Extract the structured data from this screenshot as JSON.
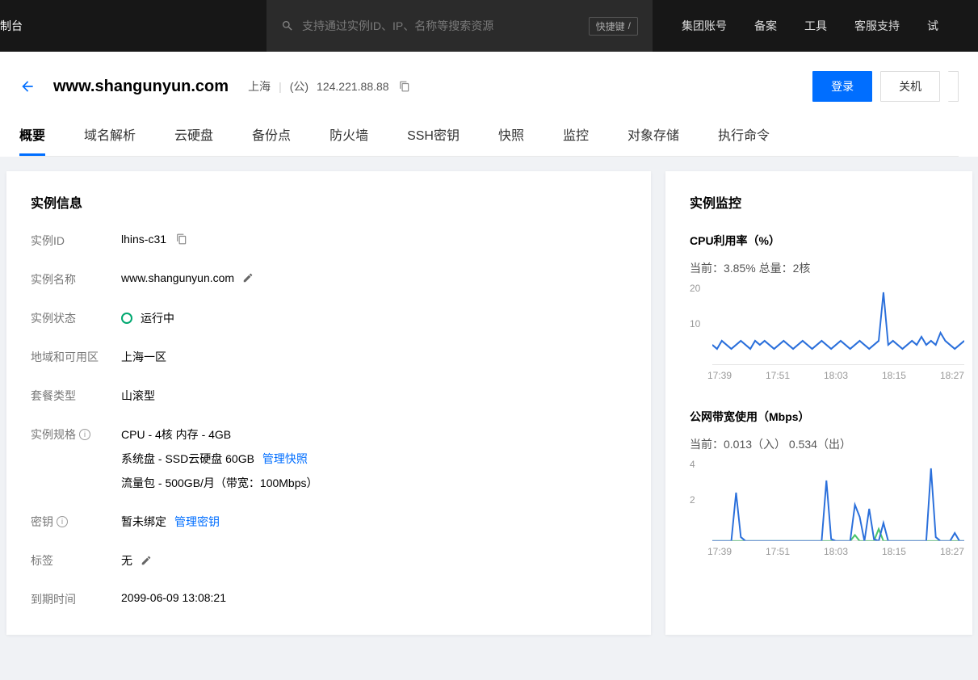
{
  "topbar": {
    "console": "制台",
    "search_placeholder": "支持通过实例ID、IP、名称等搜索资源",
    "hotkey_label": "快捷键",
    "links": [
      "集团账号",
      "备案",
      "工具",
      "客服支持",
      "试"
    ]
  },
  "header": {
    "title": "www.shangunyun.com",
    "region": "上海",
    "ip_prefix": "(公)",
    "ip": "124.221.88.88",
    "btn_login": "登录",
    "btn_shutdown": "关机"
  },
  "tabs": [
    "概要",
    "域名解析",
    "云硬盘",
    "备份点",
    "防火墙",
    "SSH密钥",
    "快照",
    "监控",
    "对象存储",
    "执行命令"
  ],
  "active_tab": 0,
  "info": {
    "panel_title": "实例信息",
    "labels": {
      "id": "实例ID",
      "name": "实例名称",
      "status": "实例状态",
      "zone": "地域和可用区",
      "plan": "套餐类型",
      "spec": "实例规格",
      "key": "密钥",
      "tag": "标签",
      "expire": "到期时间"
    },
    "id": "lhins-c31",
    "name": "www.shangunyun.com",
    "status": "运行中",
    "zone": "上海一区",
    "plan": "山滚型",
    "spec_cpu": "CPU - 4核 内存 - 4GB",
    "spec_disk": "系统盘 - SSD云硬盘 60GB",
    "spec_disk_link": "管理快照",
    "spec_bw": "流量包 - 500GB/月（带宽：100Mbps）",
    "key_value": "暂未绑定",
    "key_link": "管理密钥",
    "tag_value": "无",
    "expire": "2099-06-09 13:08:21"
  },
  "monitor": {
    "panel_title": "实例监控",
    "cpu": {
      "title": "CPU利用率（%）",
      "sub": "当前：3.85% 总量：2核"
    },
    "bw": {
      "title": "公网带宽使用（Mbps）",
      "sub": "当前：0.013（入） 0.534（出）"
    },
    "xlabels": [
      "17:39",
      "17:51",
      "18:03",
      "18:15",
      "18:27"
    ]
  },
  "chart_data": [
    {
      "type": "line",
      "title": "CPU利用率（%）",
      "xlabel": "",
      "ylabel": "%",
      "ylim": [
        0,
        20
      ],
      "yticks": [
        10,
        20
      ],
      "x_ticks": [
        "17:39",
        "17:51",
        "18:03",
        "18:15",
        "18:27"
      ],
      "series": [
        {
          "name": "CPU",
          "color": "#2a6fdb",
          "values": [
            5,
            4,
            6,
            5,
            4,
            5,
            6,
            5,
            4,
            6,
            5,
            6,
            5,
            4,
            5,
            6,
            5,
            4,
            5,
            6,
            5,
            4,
            5,
            6,
            5,
            4,
            5,
            6,
            5,
            4,
            5,
            6,
            5,
            4,
            5,
            6,
            18,
            5,
            6,
            5,
            4,
            5,
            6,
            5,
            7,
            5,
            6,
            5,
            8,
            6,
            5,
            4,
            5,
            6
          ]
        }
      ]
    },
    {
      "type": "line",
      "title": "公网带宽使用（Mbps）",
      "xlabel": "",
      "ylabel": "Mbps",
      "ylim": [
        0,
        4
      ],
      "yticks": [
        2,
        4
      ],
      "x_ticks": [
        "17:39",
        "17:51",
        "18:03",
        "18:15",
        "18:27"
      ],
      "series": [
        {
          "name": "入",
          "color": "#49c46c",
          "values": [
            0,
            0,
            0,
            0,
            0,
            0,
            0,
            0,
            0,
            0,
            0,
            0,
            0,
            0,
            0,
            0,
            0,
            0,
            0,
            0,
            0,
            0,
            0,
            0,
            0,
            0,
            0,
            0,
            0,
            0,
            0.3,
            0,
            0,
            0,
            0,
            0.6,
            0,
            0,
            0,
            0,
            0,
            0,
            0,
            0,
            0,
            0,
            0,
            0,
            0,
            0,
            0,
            0,
            0,
            0
          ]
        },
        {
          "name": "出",
          "color": "#2a6fdb",
          "values": [
            0,
            0,
            0,
            0,
            0,
            2.4,
            0.2,
            0,
            0,
            0,
            0,
            0,
            0,
            0,
            0,
            0,
            0,
            0,
            0,
            0,
            0,
            0,
            0,
            0,
            3.0,
            0.1,
            0,
            0,
            0,
            0,
            1.8,
            1.2,
            0,
            1.6,
            0.1,
            0,
            0.9,
            0,
            0,
            0,
            0,
            0,
            0,
            0,
            0,
            0,
            3.6,
            0.2,
            0,
            0,
            0,
            0.4,
            0,
            0
          ]
        }
      ]
    }
  ]
}
